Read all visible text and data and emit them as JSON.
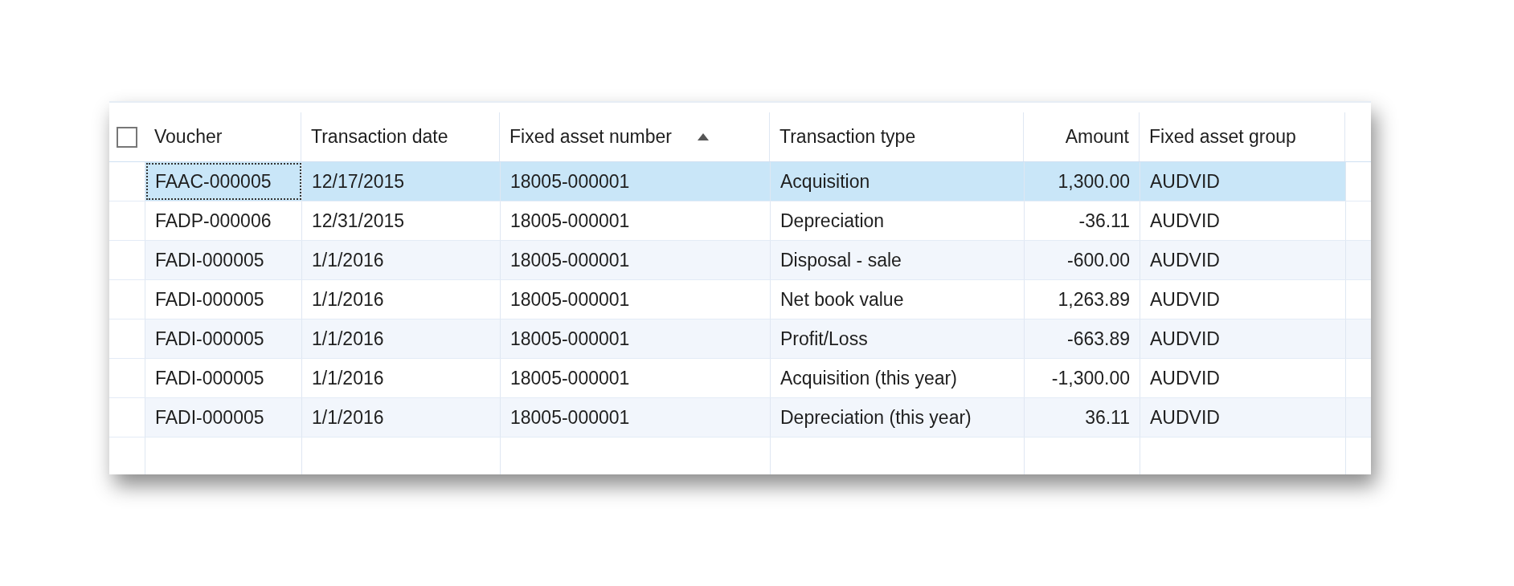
{
  "grid": {
    "select_all": {
      "checked": false
    },
    "columns": [
      {
        "label": "Voucher",
        "numeric": false,
        "sorted": false
      },
      {
        "label": "Transaction date",
        "numeric": false,
        "sorted": false
      },
      {
        "label": "Fixed asset number",
        "numeric": false,
        "sorted": true
      },
      {
        "label": "Transaction type",
        "numeric": false,
        "sorted": false
      },
      {
        "label": "Amount",
        "numeric": true,
        "sorted": false
      },
      {
        "label": "Fixed asset group",
        "numeric": false,
        "sorted": false
      }
    ],
    "rows": [
      {
        "selected": true,
        "focused": true,
        "cells": [
          "FAAC-000005",
          "12/17/2015",
          "18005-000001",
          "Acquisition",
          "1,300.00",
          "AUDVID"
        ]
      },
      {
        "selected": false,
        "focused": false,
        "cells": [
          "FADP-000006",
          "12/31/2015",
          "18005-000001",
          "Depreciation",
          "-36.11",
          "AUDVID"
        ]
      },
      {
        "selected": false,
        "focused": false,
        "cells": [
          "FADI-000005",
          "1/1/2016",
          "18005-000001",
          "Disposal - sale",
          "-600.00",
          "AUDVID"
        ]
      },
      {
        "selected": false,
        "focused": false,
        "cells": [
          "FADI-000005",
          "1/1/2016",
          "18005-000001",
          "Net book value",
          "1,263.89",
          "AUDVID"
        ]
      },
      {
        "selected": false,
        "focused": false,
        "cells": [
          "FADI-000005",
          "1/1/2016",
          "18005-000001",
          "Profit/Loss",
          "-663.89",
          "AUDVID"
        ]
      },
      {
        "selected": false,
        "focused": false,
        "cells": [
          "FADI-000005",
          "1/1/2016",
          "18005-000001",
          "Acquisition (this year)",
          "-1,300.00",
          "AUDVID"
        ]
      },
      {
        "selected": false,
        "focused": false,
        "cells": [
          "FADI-000005",
          "1/1/2016",
          "18005-000001",
          "Depreciation (this year)",
          "36.11",
          "AUDVID"
        ]
      }
    ]
  }
}
